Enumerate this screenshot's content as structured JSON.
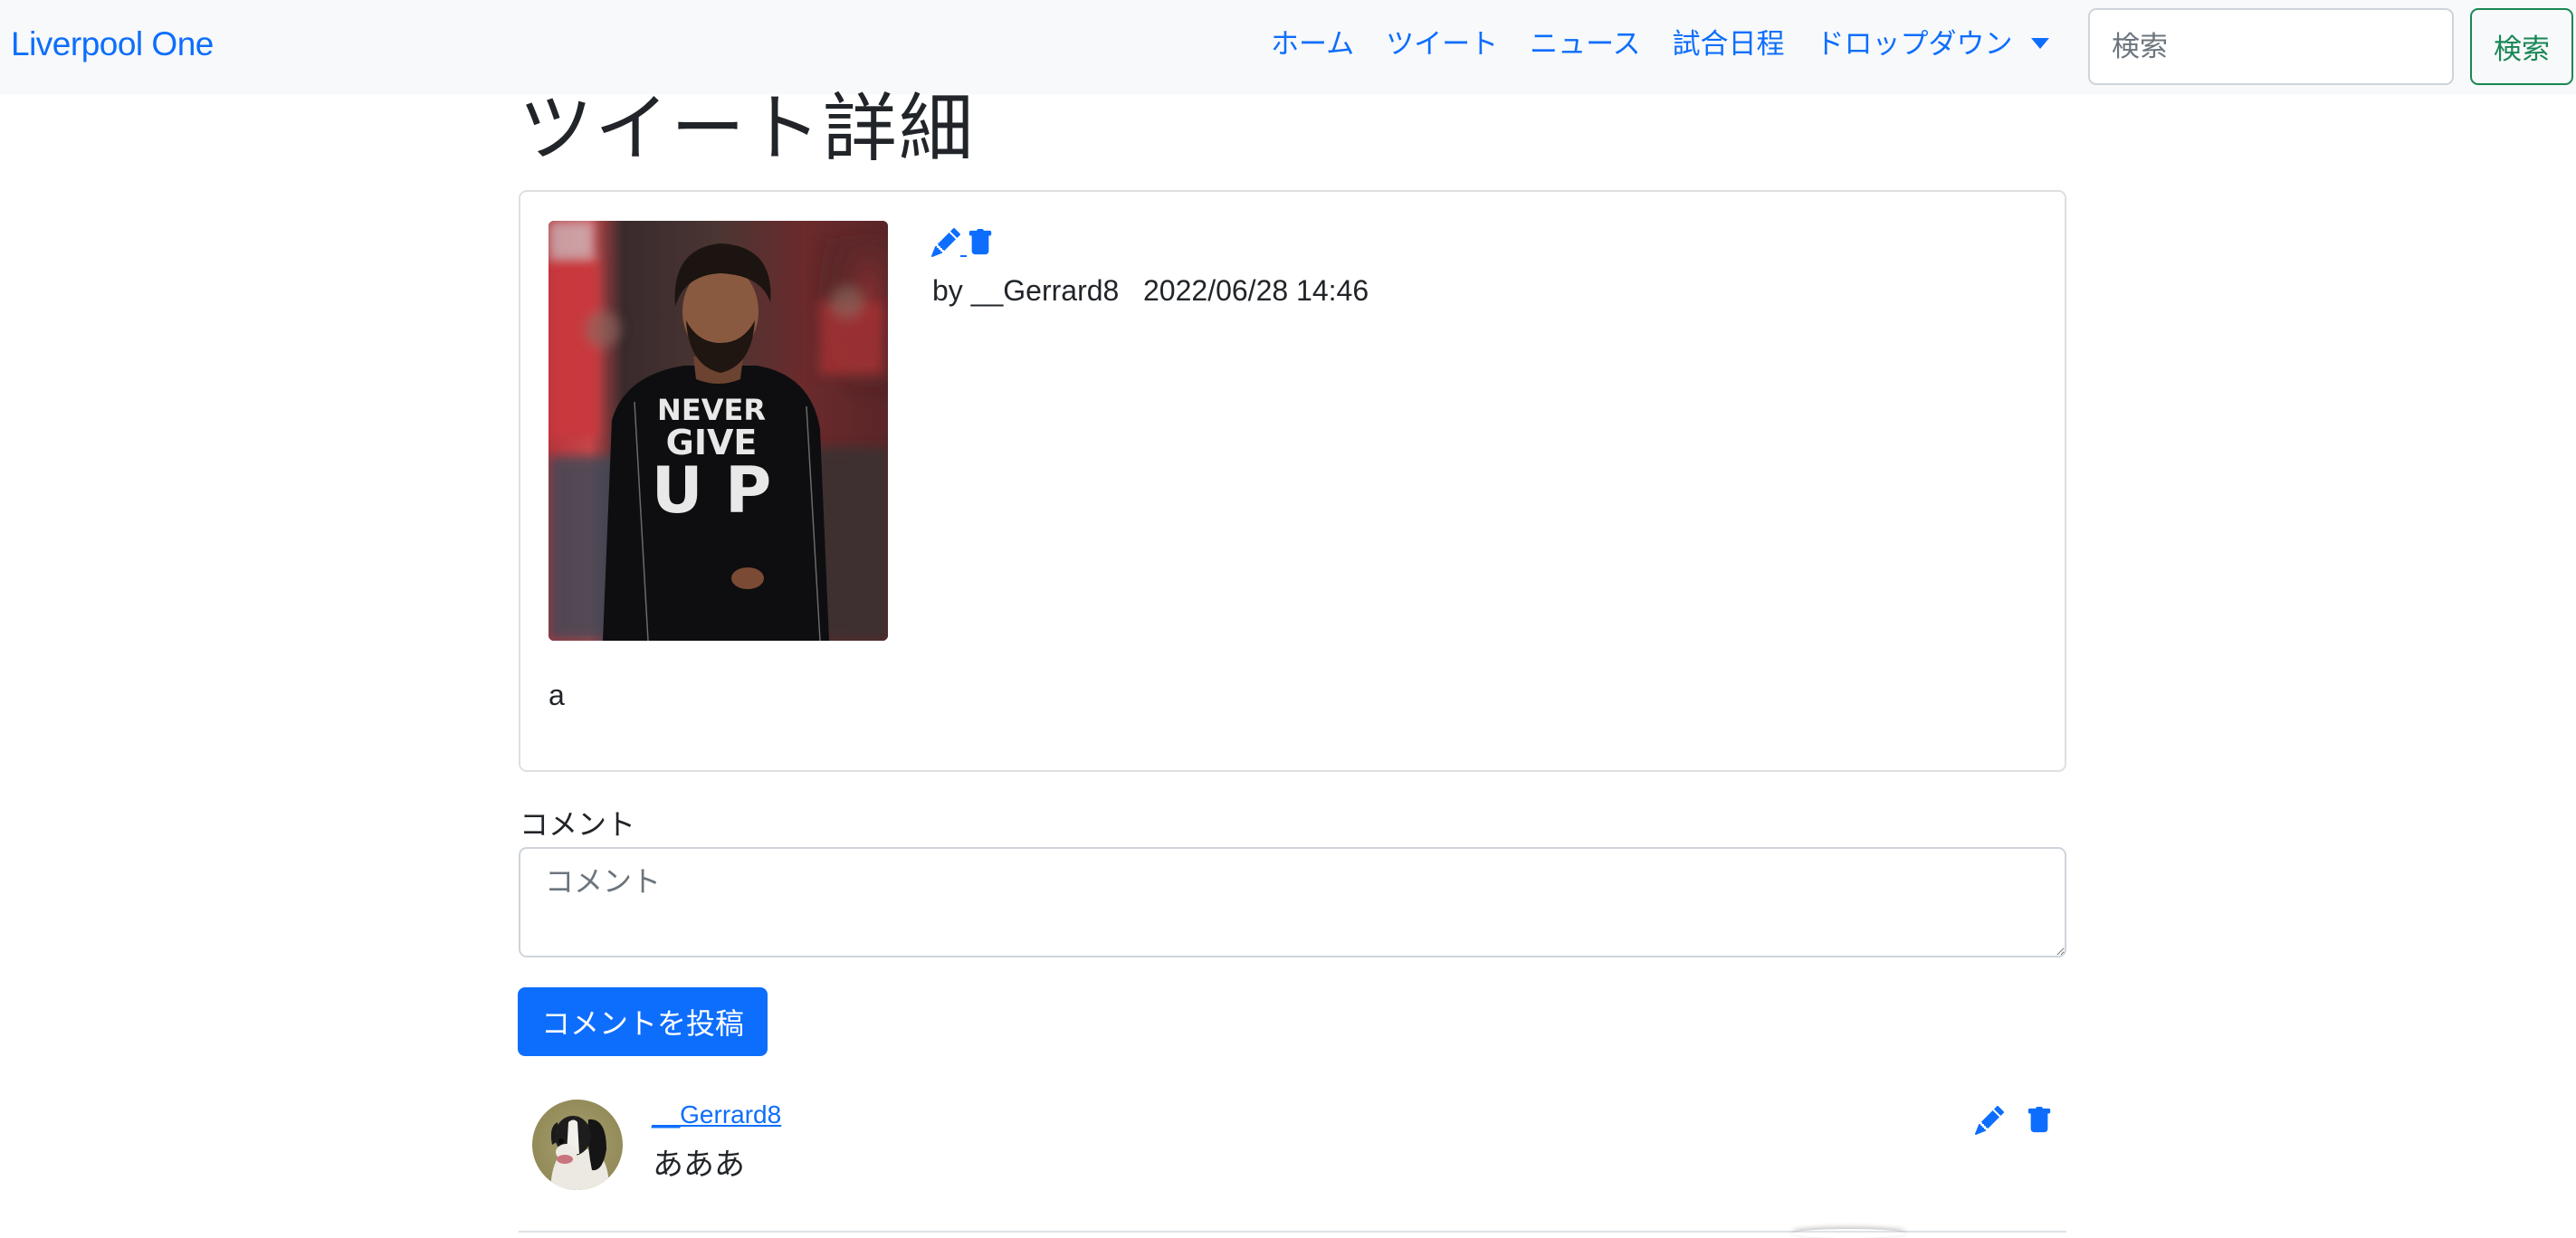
{
  "navbar": {
    "brand": "Liverpool One",
    "links": [
      {
        "label": "ホーム"
      },
      {
        "label": "ツイート"
      },
      {
        "label": "ニュース"
      },
      {
        "label": "試合日程"
      },
      {
        "label": "ドロップダウン"
      }
    ],
    "search": {
      "placeholder": "検索",
      "value": "",
      "button_label": "検索"
    }
  },
  "page": {
    "title": "ツイート詳細"
  },
  "tweet": {
    "image_alt": "NEVER GIVE UP",
    "shirt_text": [
      "NEVER",
      "GIVE",
      "UP"
    ],
    "author_line": "by __Gerrard8   2022/06/28 14:46",
    "author": "__Gerrard8",
    "timestamp": "2022/06/28 14:46",
    "body": "a",
    "actions": {
      "edit_icon": "pencil-icon",
      "delete_icon": "trash-icon"
    }
  },
  "comment_form": {
    "label": "コメント",
    "placeholder": "コメント",
    "value": "",
    "submit_label": "コメントを投稿"
  },
  "comments": [
    {
      "username": "__Gerrard8",
      "text": "あああ",
      "avatar": "dog-avatar",
      "actions": {
        "edit_icon": "pencil-icon",
        "delete_icon": "trash-icon"
      }
    }
  ],
  "colors": {
    "primary": "#0d6efd",
    "success": "#198754",
    "navbar_bg": "#f8f9fa",
    "text": "#212529"
  }
}
